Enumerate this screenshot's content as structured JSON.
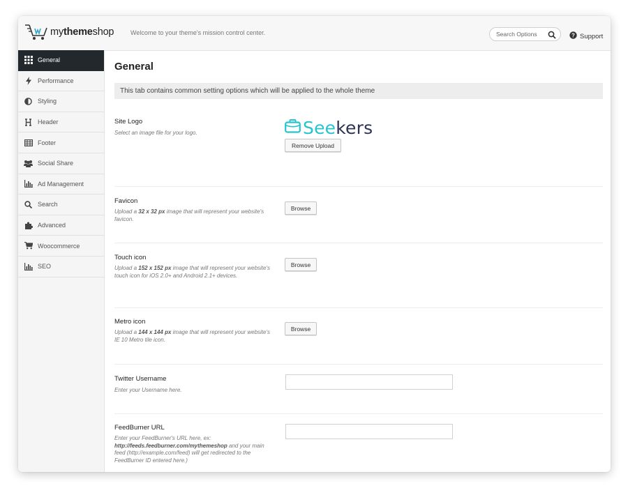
{
  "app": {
    "brand_prefix": "my",
    "brand_bold": "theme",
    "brand_suffix": "shop",
    "welcome": "Welcome to your theme's mission control center."
  },
  "search": {
    "placeholder": "Search Options",
    "icon": "search-icon"
  },
  "support": {
    "label": "Support",
    "icon": "question-circle-icon"
  },
  "sidebar": {
    "items": [
      {
        "label": "General",
        "icon": "grid-icon",
        "active": true
      },
      {
        "label": "Performance",
        "icon": "bolt-icon"
      },
      {
        "label": "Styling",
        "icon": "contrast-icon"
      },
      {
        "label": "Header",
        "icon": "header-h-icon"
      },
      {
        "label": "Footer",
        "icon": "table-icon"
      },
      {
        "label": "Social Share",
        "icon": "users-icon"
      },
      {
        "label": "Ad Management",
        "icon": "bar-chart-icon"
      },
      {
        "label": "Search",
        "icon": "search-icon"
      },
      {
        "label": "Advanced",
        "icon": "puzzle-icon"
      },
      {
        "label": "Woocommerce",
        "icon": "cart-icon"
      },
      {
        "label": "SEO",
        "icon": "bar-chart-icon"
      }
    ]
  },
  "main": {
    "title": "General",
    "notice": "This tab contains common setting options which will be applied to the whole theme",
    "site_logo": {
      "title": "Site Logo",
      "desc": "Select an image file for your logo.",
      "logo_text_a": "See",
      "logo_text_b": "kers",
      "remove_label": "Remove Upload"
    },
    "favicon": {
      "title": "Favicon",
      "desc_pre": "Upload a ",
      "desc_bold": "32 x 32 px",
      "desc_post": " image that will represent your website's favicon.",
      "button": "Browse"
    },
    "touch_icon": {
      "title": "Touch icon",
      "desc_pre": "Upload a ",
      "desc_bold": "152 x 152 px",
      "desc_post": " image that will represent your website's touch icon for iOS 2.0+ and Android 2.1+ devices.",
      "button": "Browse"
    },
    "metro_icon": {
      "title": "Metro icon",
      "desc_pre": "Upload a ",
      "desc_bold": "144 x 144 px",
      "desc_post": " image that will represent your website's IE 10 Metro tile icon.",
      "button": "Browse"
    },
    "twitter": {
      "title": "Twitter Username",
      "desc": "Enter your Username here.",
      "value": ""
    },
    "feedburner": {
      "title": "FeedBurner URL",
      "desc_pre": "Enter your FeedBurner's URL here, ex: ",
      "desc_bold": "http://feeds.feedburner.com/mythemeshop",
      "desc_post": " and your main feed (http://example.com/feed) will get redirected to the FeedBurner ID entered here.)",
      "value": ""
    }
  },
  "colors": {
    "sidebar_active": "#23282d",
    "seekers_accent": "#27c4cf",
    "seekers_dark": "#2e3454"
  }
}
